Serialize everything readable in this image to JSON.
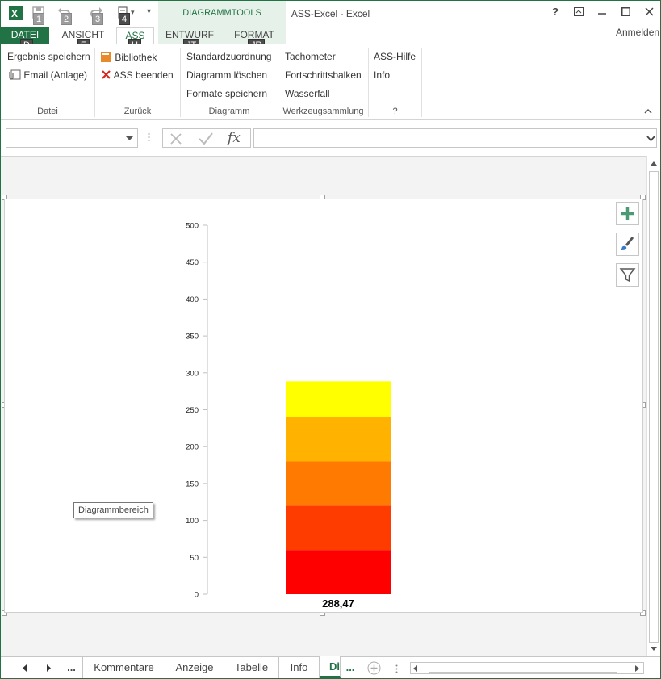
{
  "window": {
    "title": "ASS-Excel - Excel",
    "help": "?",
    "sign_in": "Anmelden"
  },
  "quick_access": {
    "keytips": [
      "1",
      "2",
      "3",
      "4"
    ]
  },
  "context_tools": {
    "label": "DIAGRAMMTOOLS"
  },
  "tabs": [
    {
      "label": "DATEI",
      "keytip": "D"
    },
    {
      "label": "ANSICHT",
      "keytip": "F"
    },
    {
      "label": "ASS",
      "keytip": "U"
    },
    {
      "label": "ENTWURF",
      "keytip": "JT"
    },
    {
      "label": "FORMAT",
      "keytip": "JR"
    }
  ],
  "ribbon": {
    "datei": {
      "group": "Datei",
      "save": "Ergebnis speichern",
      "email": "Email (Anlage)"
    },
    "zurueck": {
      "group": "Zurück",
      "library": "Bibliothek",
      "quit": "ASS beenden"
    },
    "diagramm": {
      "group": "Diagramm",
      "default": "Standardzuordnung",
      "delete": "Diagramm löschen",
      "save_formats": "Formate speichern"
    },
    "werkzeug": {
      "group": "Werkzeugsammlung",
      "tacho": "Tachometer",
      "progress": "Fortschrittsbalken",
      "waterfall": "Wasserfall"
    },
    "hilfe": {
      "group": "?",
      "help": "ASS-Hilfe",
      "info": "Info"
    }
  },
  "formula_bar": {
    "fx": "fx"
  },
  "chart_data": {
    "type": "bar",
    "stacked": true,
    "categories": [
      "288,47"
    ],
    "series": [
      {
        "values": [
          60
        ],
        "color": "#FF0000"
      },
      {
        "values": [
          60
        ],
        "color": "#FF3C00"
      },
      {
        "values": [
          60
        ],
        "color": "#FF7A00"
      },
      {
        "values": [
          60
        ],
        "color": "#FFB300"
      },
      {
        "values": [
          48.47
        ],
        "color": "#FFFF00"
      }
    ],
    "ylim": [
      0,
      500
    ],
    "yticks": [
      "0",
      "50",
      "100",
      "150",
      "200",
      "250",
      "300",
      "350",
      "400",
      "450",
      "500"
    ],
    "total": 288.47,
    "total_label": "288,47",
    "grid": false,
    "legend": "none"
  },
  "tooltip": "Diagrammbereich",
  "sheet_tabs": [
    "...",
    "Kommentare",
    "Anzeige",
    "Tabelle",
    "Info",
    "Dia",
    "..."
  ],
  "accent": "#217346"
}
